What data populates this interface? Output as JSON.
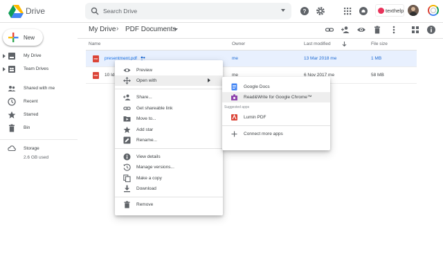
{
  "app": {
    "name": "Drive"
  },
  "search": {
    "placeholder": "Search Drive"
  },
  "header": {
    "brand_label": "texthelp"
  },
  "sidebar": {
    "new_label": "New",
    "items": [
      {
        "label": "My Drive",
        "icon": "my-drive-icon"
      },
      {
        "label": "Team Drives",
        "icon": "team-drives-icon"
      },
      {
        "label": "Shared with me",
        "icon": "shared-icon"
      },
      {
        "label": "Recent",
        "icon": "clock-icon"
      },
      {
        "label": "Starred",
        "icon": "star-icon"
      },
      {
        "label": "Bin",
        "icon": "trash-icon"
      }
    ],
    "storage_label": "Storage",
    "storage_used": "2.6 GB used"
  },
  "breadcrumb": {
    "root": "My Drive",
    "separator": "›",
    "current": "PDF Documents"
  },
  "table": {
    "headers": {
      "name": "Name",
      "owner": "Owner",
      "modified": "Last modified",
      "size": "File size"
    },
    "rows": [
      {
        "name": "presentment.pdf",
        "owner": "me",
        "modified": "13 Mar 2018 me",
        "size": "1 MB"
      },
      {
        "name": "10 Id",
        "owner": "me",
        "modified": "6 Nov 2017 me",
        "size": "58 MB"
      }
    ]
  },
  "context_menu": {
    "items": [
      {
        "label": "Preview"
      },
      {
        "label": "Open with"
      },
      {
        "label": "Share..."
      },
      {
        "label": "Get shareable link"
      },
      {
        "label": "Move to..."
      },
      {
        "label": "Add star"
      },
      {
        "label": "Rename..."
      },
      {
        "label": "View details"
      },
      {
        "label": "Manage versions..."
      },
      {
        "label": "Make a copy"
      },
      {
        "label": "Download"
      },
      {
        "label": "Remove"
      }
    ]
  },
  "open_with_menu": {
    "items": [
      {
        "label": "Google Docs"
      },
      {
        "label": "Read&Write for Google Chrome™"
      }
    ],
    "suggested_label": "Suggested apps",
    "suggested": [
      {
        "label": "Lumin PDF"
      }
    ],
    "connect_label": "Connect more apps"
  },
  "colors": {
    "accent": "#1a73e8",
    "selected_row": "#e8f0fe",
    "pdf_red": "#db4437"
  }
}
